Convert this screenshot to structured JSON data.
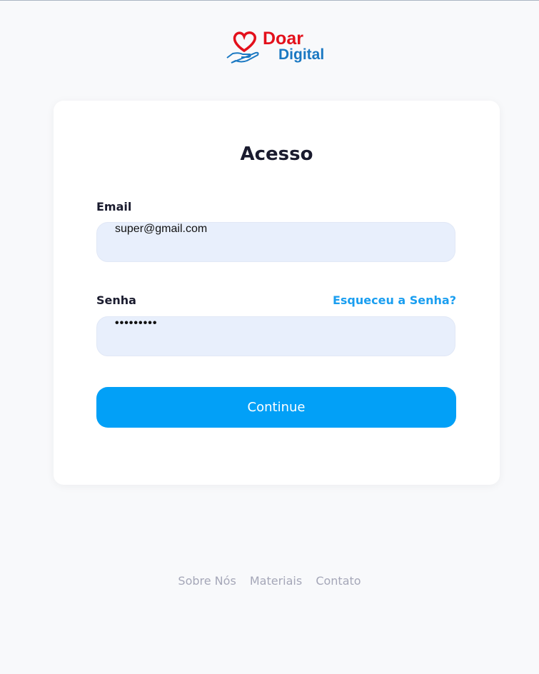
{
  "logo": {
    "line1": "Doar",
    "line2": "Digital"
  },
  "title": "Acesso",
  "email": {
    "label": "Email",
    "value": "super@gmail.com"
  },
  "password": {
    "label": "Senha",
    "value": "•••••••••",
    "forgot": "Esqueceu a Senha?"
  },
  "submit": "Continue",
  "footer": [
    "Sobre Nós",
    "Materiais",
    "Contato"
  ]
}
